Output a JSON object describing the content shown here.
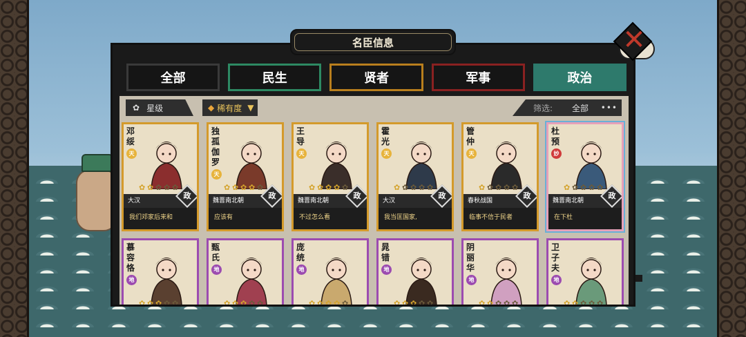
{
  "title": "名臣信息",
  "tabs": [
    {
      "label": "全部"
    },
    {
      "label": "民生"
    },
    {
      "label": "贤者"
    },
    {
      "label": "军事"
    },
    {
      "label": "政治"
    }
  ],
  "filters": {
    "star_label": "星级",
    "rarity_label": "稀有度",
    "filter_label": "筛选:",
    "filter_value": "全部",
    "more": "•••"
  },
  "cards": [
    {
      "name": "邓绥",
      "rank": "天",
      "stars": 2,
      "type": "政",
      "era": "大汉",
      "quote": "我们邓家后来和"
    },
    {
      "name": "独孤伽罗",
      "rank": "天",
      "stars": 4,
      "type": "政",
      "era": "魏晋南北朝",
      "quote": "应该有"
    },
    {
      "name": "王导",
      "rank": "天",
      "stars": 4,
      "type": "政",
      "era": "魏晋南北朝",
      "quote": "不过怎么看"
    },
    {
      "name": "霍光",
      "rank": "天",
      "stars": 1,
      "type": "政",
      "era": "大汉",
      "quote": "我当匡国家,"
    },
    {
      "name": "管仲",
      "rank": "天",
      "stars": 1,
      "type": "政",
      "era": "春秋战国",
      "quote": "临事不信于民者"
    },
    {
      "name": "杜预",
      "rank": "妙",
      "stars": 1,
      "type": "政",
      "era": "魏晋南北朝",
      "quote": "在下杜"
    },
    {
      "name": "慕容恪",
      "rank": "地",
      "stars": 3,
      "type": "",
      "era": "",
      "quote": ""
    },
    {
      "name": "甄氏",
      "rank": "地",
      "stars": 3,
      "type": "",
      "era": "",
      "quote": ""
    },
    {
      "name": "庞统",
      "rank": "地",
      "stars": 4,
      "type": "",
      "era": "",
      "quote": ""
    },
    {
      "name": "晁错",
      "rank": "地",
      "stars": 3,
      "type": "",
      "era": "",
      "quote": ""
    },
    {
      "name": "阴丽华",
      "rank": "地",
      "stars": 2,
      "type": "",
      "era": "",
      "quote": ""
    },
    {
      "name": "卫子夫",
      "rank": "地",
      "stars": 2,
      "type": "",
      "era": "",
      "quote": ""
    }
  ],
  "colors": {
    "gold": "#d49a2b",
    "purple": "#9c4bb0",
    "teal": "#2e7a6c"
  }
}
